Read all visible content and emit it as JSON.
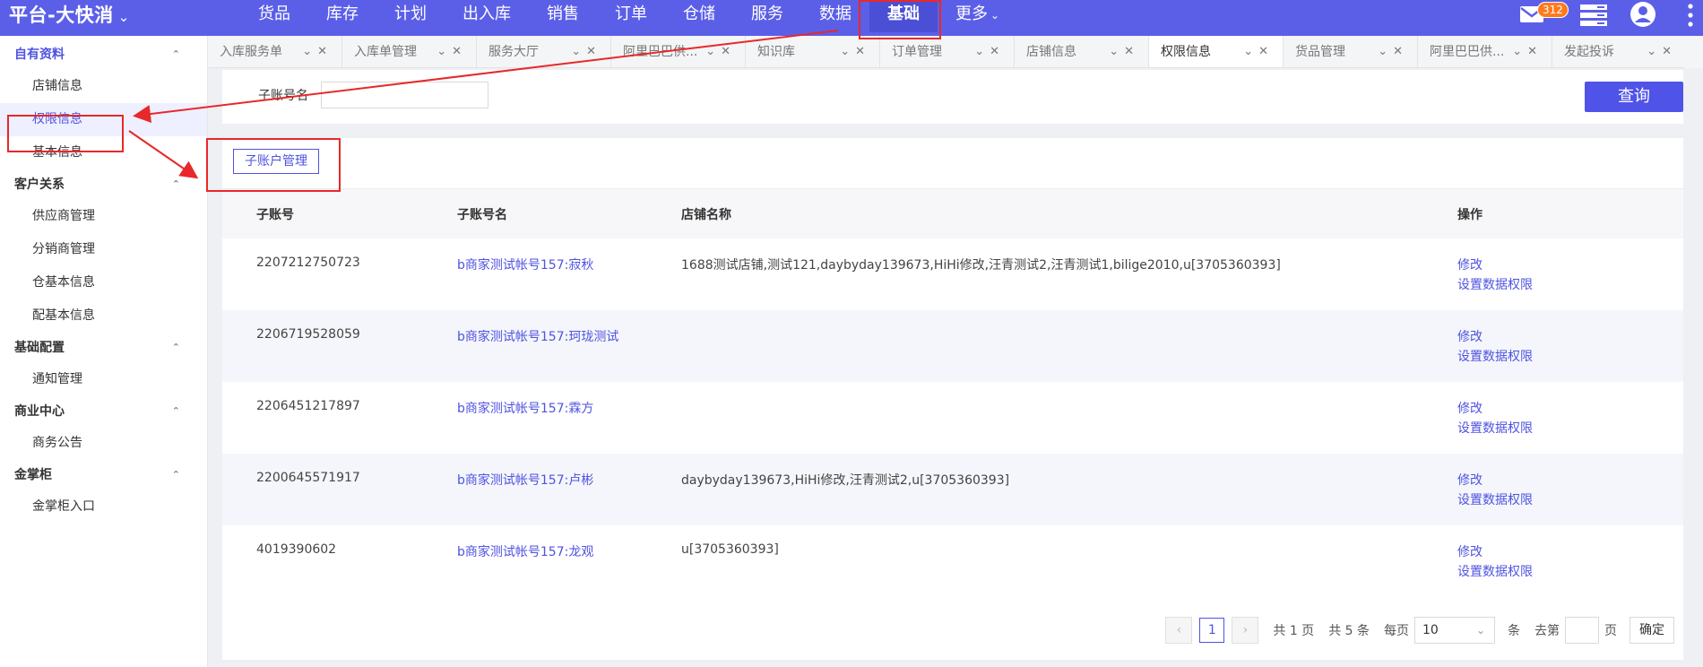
{
  "header": {
    "brand": "平台-大快消",
    "nav": [
      {
        "label": "货品"
      },
      {
        "label": "库存"
      },
      {
        "label": "计划"
      },
      {
        "label": "出入库"
      },
      {
        "label": "销售"
      },
      {
        "label": "订单"
      },
      {
        "label": "仓储"
      },
      {
        "label": "服务"
      },
      {
        "label": "数据"
      },
      {
        "label": "基础",
        "active": true
      }
    ],
    "more_label": "更多",
    "mail_badge": "312",
    "accent_color": "#5b5fe8"
  },
  "sidebar": {
    "groups": [
      {
        "label": "自有资料",
        "active": true,
        "items": [
          "店铺信息",
          "权限信息",
          "基本信息"
        ],
        "selected": "权限信息"
      },
      {
        "label": "客户关系",
        "items": [
          "供应商管理",
          "分销商管理",
          "仓基本信息",
          "配基本信息"
        ]
      },
      {
        "label": "基础配置",
        "items": [
          "通知管理"
        ]
      },
      {
        "label": "商业中心",
        "items": [
          "商务公告"
        ]
      },
      {
        "label": "金掌柜",
        "items": [
          "金掌柜入口"
        ]
      }
    ]
  },
  "tabs": [
    {
      "label": "入库服务单"
    },
    {
      "label": "入库单管理"
    },
    {
      "label": "服务大厅"
    },
    {
      "label": "阿里巴巴供..."
    },
    {
      "label": "知识库"
    },
    {
      "label": "订单管理"
    },
    {
      "label": "店铺信息"
    },
    {
      "label": "权限信息",
      "active": true
    },
    {
      "label": "货品管理"
    },
    {
      "label": "阿里巴巴供..."
    },
    {
      "label": "发起投诉"
    }
  ],
  "search": {
    "label": "子账号名",
    "value": "",
    "query_button": "查询"
  },
  "main": {
    "sub_account_button": "子账户管理",
    "columns": [
      "子账号",
      "子账号名",
      "店铺名称",
      "操作"
    ],
    "rows": [
      {
        "id": "2207212750723",
        "name": "b商家测试帐号157:寂秋",
        "shops": "1688测试店铺,测试121,daybyday139673,HiHi修改,汪青测试2,汪青测试1,bilige2010,u[3705360393]"
      },
      {
        "id": "2206719528059",
        "name": "b商家测试帐号157:珂珑测试",
        "shops": ""
      },
      {
        "id": "2206451217897",
        "name": "b商家测试帐号157:霖方",
        "shops": ""
      },
      {
        "id": "2200645571917",
        "name": "b商家测试帐号157:卢彬",
        "shops": "daybyday139673,HiHi修改,汪青测试2,u[3705360393]"
      },
      {
        "id": "4019390602",
        "name": "b商家测试帐号157:龙观",
        "shops": "u[3705360393]"
      }
    ],
    "op_edit": "修改",
    "op_perm": "设置数据权限"
  },
  "pagination": {
    "prev": "‹",
    "current": "1",
    "next": "›",
    "total_pages": "共 1 页",
    "total_items": "共 5 条",
    "per_page_label": "每页",
    "per_page_value": "10",
    "per_page_unit": "条",
    "goto_label": "去第",
    "goto_unit": "页",
    "confirm": "确定"
  }
}
